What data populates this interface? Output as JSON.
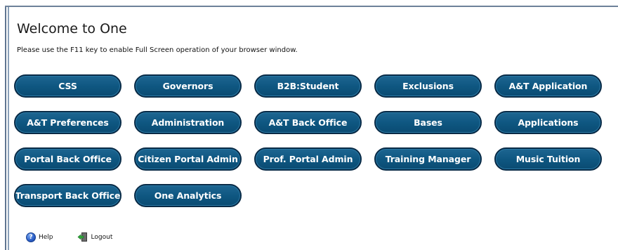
{
  "header": {
    "title": "Welcome to One",
    "subtitle": "Please use the F11 key to enable Full Screen operation of your browser window."
  },
  "tiles": [
    {
      "label": "CSS"
    },
    {
      "label": "Governors"
    },
    {
      "label": "B2B:Student"
    },
    {
      "label": "Exclusions"
    },
    {
      "label": "A&T Application"
    },
    {
      "label": "A&T Preferences"
    },
    {
      "label": "Administration"
    },
    {
      "label": "A&T Back Office"
    },
    {
      "label": "Bases"
    },
    {
      "label": "Applications"
    },
    {
      "label": "Portal Back Office"
    },
    {
      "label": "Citizen Portal Admin"
    },
    {
      "label": "Prof. Portal Admin"
    },
    {
      "label": "Training Manager"
    },
    {
      "label": "Music Tuition"
    },
    {
      "label": "Transport Back Office"
    },
    {
      "label": "One Analytics"
    }
  ],
  "footer": {
    "help_label": "Help",
    "logout_label": "Logout",
    "help_icon": "help-icon",
    "logout_icon": "logout-icon"
  },
  "colors": {
    "tile_fill": "#0e5680",
    "tile_border": "#082a46",
    "tile_text": "#ffffff",
    "frame_line": "#6d8199"
  }
}
